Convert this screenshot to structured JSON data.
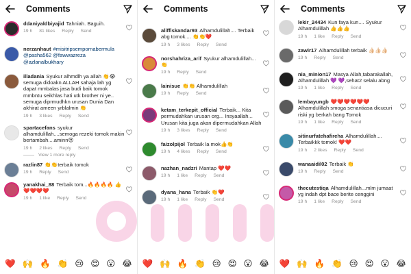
{
  "panels": [
    {
      "title": "Comments",
      "comments": [
        {
          "username": "ddaniyaldbiyajid",
          "text": "Tahniah. Baguih.",
          "time": "19 h",
          "likes": "81 likes",
          "reply": "Reply",
          "send": "Send",
          "avatar_color": "#2b2b2b",
          "story": true
        },
        {
          "username": "nerzanhaut",
          "text": "#misitripsempornabermula @pasha562 @fawwazreza @azlanalbukhary",
          "time": "",
          "likes": "",
          "reply": "",
          "send": "",
          "avatar_color": "#3a5aa8",
          "story": false,
          "no_meta": true
        },
        {
          "username": "illadania",
          "text": "Syukur alhmdlh ya allah 👏😭 semuga didoakn ALLAH sahaja lah yg dapat mmbalas jasa budi baik tomok mmbntu seikhlas hati utk brother ni ye.. semuga diprmudhkn urusan Dunia Dan akhirat ameen yrblalmin 👏",
          "time": "19 h",
          "likes": "3 likes",
          "reply": "Reply",
          "send": "Send",
          "avatar_color": "#8a5a3c",
          "story": false
        },
        {
          "username": "spartacefans",
          "text": "syukur alhamdulillah....semoga rezeki tomok makin bertambah....aminn😍",
          "time": "19 h",
          "likes": "2 likes",
          "reply": "Reply",
          "send": "Send",
          "avatar_color": "#e8e8e8",
          "story": false
        },
        {
          "username": "razlin87",
          "text": "👏👏terbaik tomok",
          "time": "19 h",
          "likes": "",
          "reply": "Reply",
          "send": "Send",
          "avatar_color": "#6b7f96",
          "story": false
        },
        {
          "username": "yanakhai_88",
          "text": "Terbaik tom...🔥🔥🔥🔥 👍❤️❤️❤️❤️",
          "time": "19 h",
          "likes": "1 like",
          "reply": "Reply",
          "send": "Send",
          "avatar_color": "#c6496a",
          "story": true
        }
      ],
      "view_more": "View 1 more reply"
    },
    {
      "title": "Comments",
      "comments": [
        {
          "username": "aliffiskandar93",
          "text": "Alhamdulillah.... Terbaik abg tomok.... 👏👏❤️",
          "time": "19 h",
          "likes": "3 likes",
          "reply": "Reply",
          "send": "Send",
          "avatar_color": "#5a4a3a",
          "story": false
        },
        {
          "username": "norshahriza_arif",
          "text": "Syukur alhamdulillah... 👏",
          "time": "19 h",
          "likes": "",
          "reply": "Reply",
          "send": "Send",
          "avatar_color": "#d98a3a",
          "story": true
        },
        {
          "username": "lainisue",
          "text": "👏👏 Alhamdulillah",
          "time": "19 h",
          "likes": "",
          "reply": "Reply",
          "send": "Send",
          "avatar_color": "#4a7a4a",
          "story": false
        },
        {
          "username": "ketam_terkepit_official",
          "text": "Terbaik... Kita permudahkan urusan org... Insyaallah... Urusan kita juga akan dipermudahkan Allah",
          "time": "19 h",
          "likes": "3 likes",
          "reply": "Reply",
          "send": "Send",
          "avatar_color": "#7a3a7a",
          "story": true
        },
        {
          "username": "faizolpijol",
          "text": "Terbaik la mok👍👏",
          "time": "19 h",
          "likes": "4 likes",
          "reply": "Reply",
          "send": "Send",
          "avatar_color": "#2e8a2e",
          "story": false
        },
        {
          "username": "nazhan_nadzri",
          "text": "Mantap ❤️❤️",
          "time": "19 h",
          "likes": "1 like",
          "reply": "Reply",
          "send": "Send",
          "avatar_color": "#8c5a6a",
          "story": false
        },
        {
          "username": "dyana_hana",
          "text": "Terbaik 👏❤️",
          "time": "19 h",
          "likes": "1 like",
          "reply": "Reply",
          "send": "Send",
          "avatar_color": "#5a6a7a",
          "story": false
        }
      ],
      "view_more": ""
    },
    {
      "title": "Comments",
      "comments": [
        {
          "username": "lekir_24434",
          "text": "Kun faya kun.... Syukur Alhamdulillah 👍👍👍",
          "time": "19 h",
          "likes": "1 like",
          "reply": "Reply",
          "send": "Send",
          "avatar_color": "#d8d8d8",
          "story": false
        },
        {
          "username": "zawir17",
          "text": "Alhamdulillah terbaik 👍🏻👍🏻👍🏻",
          "time": "19 h",
          "likes": "",
          "reply": "Reply",
          "send": "Send",
          "avatar_color": "#6a6a6a",
          "story": false
        },
        {
          "username": "nia_minion17",
          "text": "Masya Allah,tabarakallah, Alhamdulillah 💜 💜,sehat2 selalu abng",
          "time": "19 h",
          "likes": "1 like",
          "reply": "Reply",
          "send": "Send",
          "avatar_color": "#1f1f1f",
          "story": false
        },
        {
          "username": "lembayungb",
          "text": "❤️❤️❤️❤️❤️❤️ Alhamdulillah smoga senantiasa dicucuri riski yg berkah bang Tomok",
          "time": "19 h",
          "likes": "1 like",
          "reply": "Reply",
          "send": "Send",
          "avatar_color": "#5a5a5a",
          "story": false
        },
        {
          "username": "sitinurfatehafireha",
          "text": "Alhamdulillah.... Terbaikkk tomok! ❤️❤️",
          "time": "19 h",
          "likes": "2 likes",
          "reply": "Reply",
          "send": "Send",
          "avatar_color": "#3a8aa8",
          "story": false
        },
        {
          "username": "wanaaidil02",
          "text": "Terbaik 👏",
          "time": "19 h",
          "likes": "",
          "reply": "Reply",
          "send": "Send",
          "avatar_color": "#3a4a6a",
          "story": false
        },
        {
          "username": "thecutestiqa",
          "text": "Alhamdulillah...mlm jumaat yg indah dpt bace berite cenggini",
          "time": "19 h",
          "likes": "1 like",
          "reply": "Reply",
          "send": "Send",
          "avatar_color": "#c45aa8",
          "story": true
        }
      ],
      "view_more": ""
    }
  ],
  "emoji_bar": [
    "❤️",
    "🙌",
    "🔥",
    "👏",
    "😢",
    "😍",
    "😮",
    "😂"
  ],
  "icons": {
    "back": "arrow-left-icon",
    "share": "paper-plane-icon",
    "like": "heart-outline-icon"
  },
  "colors": {
    "link": "#00376b",
    "meta": "#8e8e8e",
    "story_ring": "#d62976"
  }
}
